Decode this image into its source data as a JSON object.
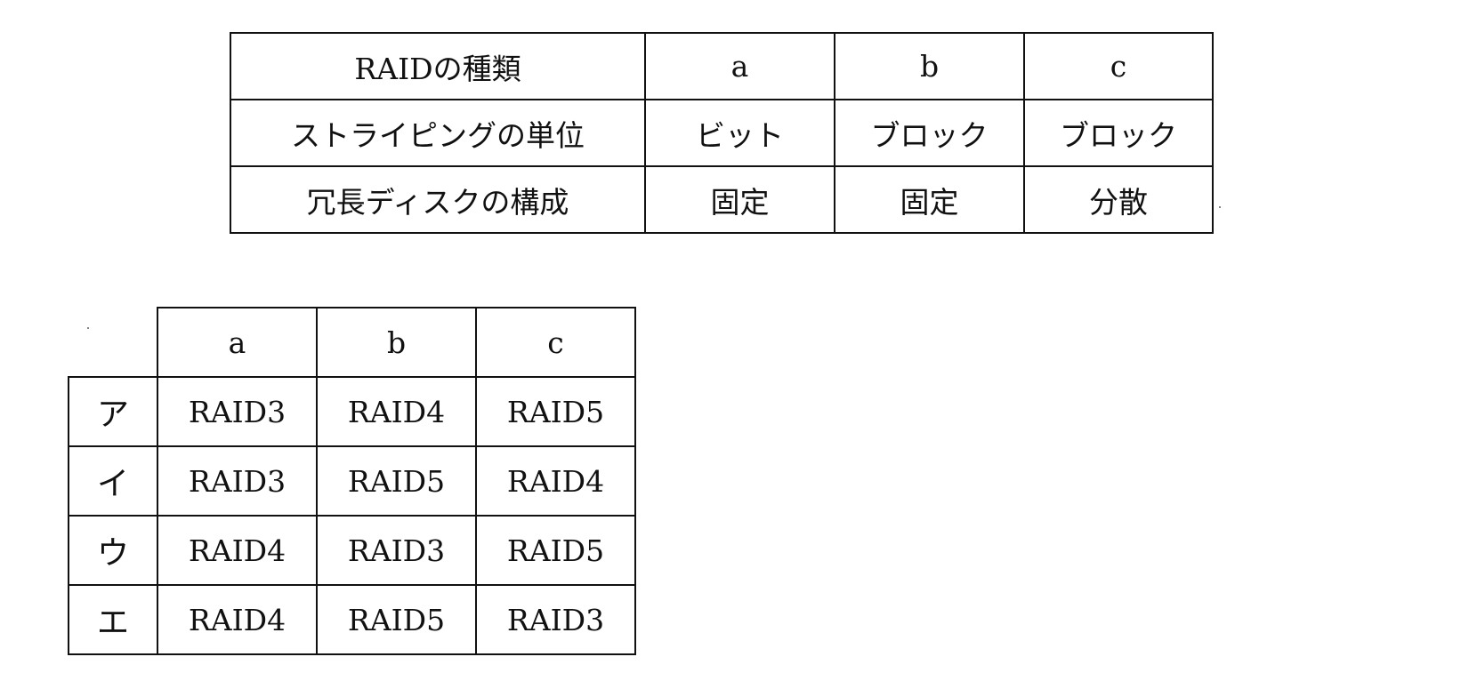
{
  "raid_table": {
    "header": [
      "RAIDの種類",
      "a",
      "b",
      "c"
    ],
    "rows": [
      {
        "label": "ストライピングの単位",
        "a": "ビット",
        "b": "ブロック",
        "c": "ブロック"
      },
      {
        "label": "冗長ディスクの構成",
        "a": "固定",
        "b": "固定",
        "c": "分散"
      }
    ]
  },
  "answer_table": {
    "header": [
      "a",
      "b",
      "c"
    ],
    "rows": [
      {
        "key": "ア",
        "a": "RAID3",
        "b": "RAID4",
        "c": "RAID5"
      },
      {
        "key": "イ",
        "a": "RAID3",
        "b": "RAID5",
        "c": "RAID4"
      },
      {
        "key": "ウ",
        "a": "RAID4",
        "b": "RAID3",
        "c": "RAID5"
      },
      {
        "key": "エ",
        "a": "RAID4",
        "b": "RAID5",
        "c": "RAID3"
      }
    ]
  }
}
